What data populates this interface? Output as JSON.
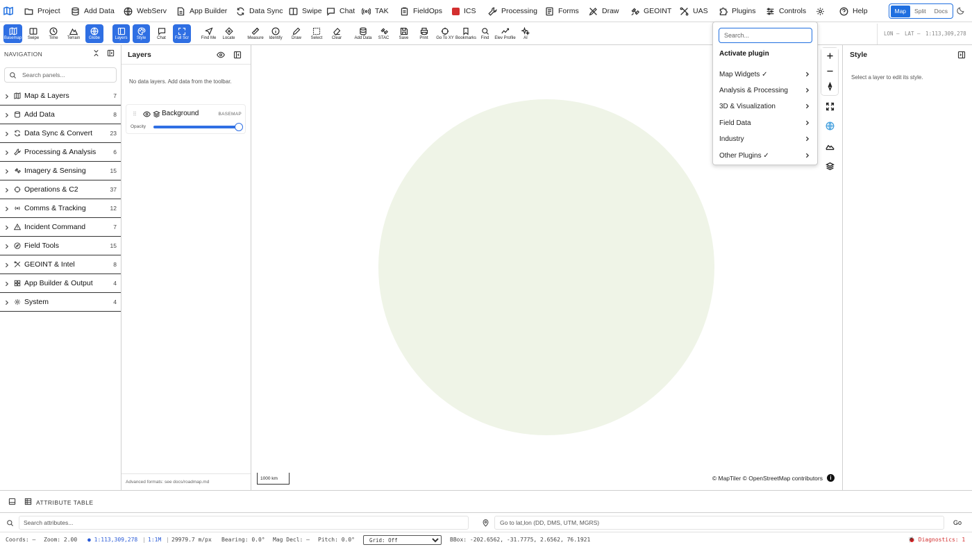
{
  "menubar": {
    "items": [
      {
        "label": "Project",
        "icon": "folder-icon"
      },
      {
        "label": "Add Data",
        "icon": "database-icon"
      },
      {
        "label": "WebServ",
        "icon": "globe-icon"
      },
      {
        "label": "App Builder",
        "icon": "document-icon"
      },
      {
        "label": "Data Sync",
        "icon": "sync-icon"
      },
      {
        "label": "Swipe",
        "icon": "swipe-icon"
      },
      {
        "label": "Chat",
        "icon": "chat-icon"
      },
      {
        "label": "TAK",
        "icon": "radio-icon"
      },
      {
        "label": "FieldOps",
        "icon": "clipboard-icon"
      },
      {
        "label": "ICS",
        "icon": "ics-icon"
      },
      {
        "label": "Processing",
        "icon": "wrench-icon"
      },
      {
        "label": "Forms",
        "icon": "form-icon"
      },
      {
        "label": "Draw",
        "icon": "draw-icon"
      },
      {
        "label": "GEOINT",
        "icon": "satellite-icon"
      },
      {
        "label": "UAS",
        "icon": "drone-icon"
      },
      {
        "label": "Plugins",
        "icon": "puzzle-icon"
      },
      {
        "label": "Controls",
        "icon": "sliders-icon"
      },
      {
        "label": "",
        "icon": "gear-icon"
      },
      {
        "label": "Help",
        "icon": "help-icon"
      }
    ],
    "view_toggle": {
      "options": [
        "Map",
        "Split",
        "Docs"
      ],
      "selected": "Map"
    }
  },
  "toolbar": {
    "tools": [
      {
        "label": "Basemap",
        "icon": "basemap-icon",
        "active": true
      },
      {
        "label": "Swipe",
        "icon": "swipe-icon",
        "active": false
      },
      {
        "label": "Time",
        "icon": "clock-icon",
        "active": false
      },
      {
        "label": "Terrain",
        "icon": "mountain-icon",
        "active": false
      },
      {
        "label": "Globe",
        "icon": "globe-icon",
        "active": true
      },
      {
        "label": "Layers",
        "icon": "layers-panel-icon",
        "active": true
      },
      {
        "label": "Style",
        "icon": "palette-icon",
        "active": true
      },
      {
        "label": "Chat",
        "icon": "chat-icon",
        "active": false
      },
      {
        "label": "Full Scr",
        "icon": "fullscreen-icon",
        "active": true
      },
      {
        "label": "Find Me",
        "icon": "navigate-icon",
        "active": false
      },
      {
        "label": "Locate",
        "icon": "locate-icon",
        "active": false
      },
      {
        "label": "Measure",
        "icon": "ruler-icon",
        "active": false
      },
      {
        "label": "Identify",
        "icon": "info-icon",
        "active": false
      },
      {
        "label": "Draw",
        "icon": "pencil-icon",
        "active": false
      },
      {
        "label": "Select",
        "icon": "select-icon",
        "active": false
      },
      {
        "label": "Clear",
        "icon": "eraser-icon",
        "active": false
      },
      {
        "label": "Add Data",
        "icon": "database-icon",
        "active": false
      },
      {
        "label": "STAC",
        "icon": "satellite-icon",
        "active": false
      },
      {
        "label": "Save",
        "icon": "save-icon",
        "active": false
      },
      {
        "label": "Print",
        "icon": "printer-icon",
        "active": false
      },
      {
        "label": "Go To XY",
        "icon": "crosshair-icon",
        "active": false
      },
      {
        "label": "Bookmarks",
        "icon": "bookmark-icon",
        "active": false
      },
      {
        "label": "Find",
        "icon": "search-icon",
        "active": false
      },
      {
        "label": "Elev Profile",
        "icon": "chart-line-icon",
        "active": false
      },
      {
        "label": "AI",
        "icon": "sparkle-icon",
        "active": false
      }
    ],
    "lon_label": "LON —",
    "lat_label": "LAT —",
    "scale": "1:113,309,278"
  },
  "navigation": {
    "title": "NAVIGATION",
    "search_placeholder": "Search panels...",
    "items": [
      {
        "label": "Map & Layers",
        "count": "7",
        "icon": "map-icon"
      },
      {
        "label": "Add Data",
        "count": "8",
        "icon": "database-icon"
      },
      {
        "label": "Data Sync & Convert",
        "count": "23",
        "icon": "sync-icon"
      },
      {
        "label": "Processing & Analysis",
        "count": "6",
        "icon": "wrench-icon"
      },
      {
        "label": "Imagery & Sensing",
        "count": "15",
        "icon": "satellite-icon"
      },
      {
        "label": "Operations & C2",
        "count": "37",
        "icon": "crosshair-icon"
      },
      {
        "label": "Comms & Tracking",
        "count": "12",
        "icon": "radio-icon"
      },
      {
        "label": "Incident Command",
        "count": "7",
        "icon": "warning-icon"
      },
      {
        "label": "Field Tools",
        "count": "15",
        "icon": "compass-icon"
      },
      {
        "label": "GEOINT & Intel",
        "count": "8",
        "icon": "intel-icon"
      },
      {
        "label": "App Builder & Output",
        "count": "4",
        "icon": "grid-icon"
      },
      {
        "label": "System",
        "count": "4",
        "icon": "gear-icon"
      }
    ]
  },
  "layers": {
    "title": "Layers",
    "empty_text": "No data layers. Add data from the toolbar.",
    "basemap": {
      "name": "Background",
      "tag": "BASEMAP",
      "opacity_label": "Opacity",
      "opacity": 1.0
    },
    "footer": "Advanced formats: see docs/roadmap.md"
  },
  "map": {
    "scale_label": "1000 km",
    "attribution": "© MapTiler © OpenStreetMap contributors",
    "globe_color": "#eff4e7"
  },
  "plugin_menu": {
    "search_placeholder": "Search...",
    "title": "Activate plugin",
    "items": [
      "Map Widgets ✓",
      "Analysis & Processing",
      "3D & Visualization",
      "Field Data",
      "Industry",
      "Other Plugins ✓"
    ]
  },
  "style_panel": {
    "title": "Style",
    "hint": "Select a layer to edit its style."
  },
  "attribute_table": {
    "label": "ATTRIBUTE TABLE",
    "search_placeholder": "Search attributes...",
    "goto_placeholder": "Go to lat,lon (DD, DMS, UTM, MGRS)",
    "go_label": "Go"
  },
  "statusbar": {
    "coords": "Coords: —",
    "zoom": "Zoom: 2.00",
    "scale": "● 1:113,309,278",
    "ratio": "1:1M",
    "resolution": "29979.7 m/px",
    "bearing": "Bearing: 0.0°",
    "mag_decl": "Mag Decl: —",
    "pitch": "Pitch: 0.0°",
    "grid": "Grid: Off",
    "bbox": "BBox: -202.6562, -31.7775, 2.6562, 76.1921",
    "diagnostics": "🐞 Diagnostics: 1"
  },
  "colors": {
    "accent": "#2f6fe3",
    "diagnostics": "#d32f2f",
    "globe": "#eff4e7"
  }
}
